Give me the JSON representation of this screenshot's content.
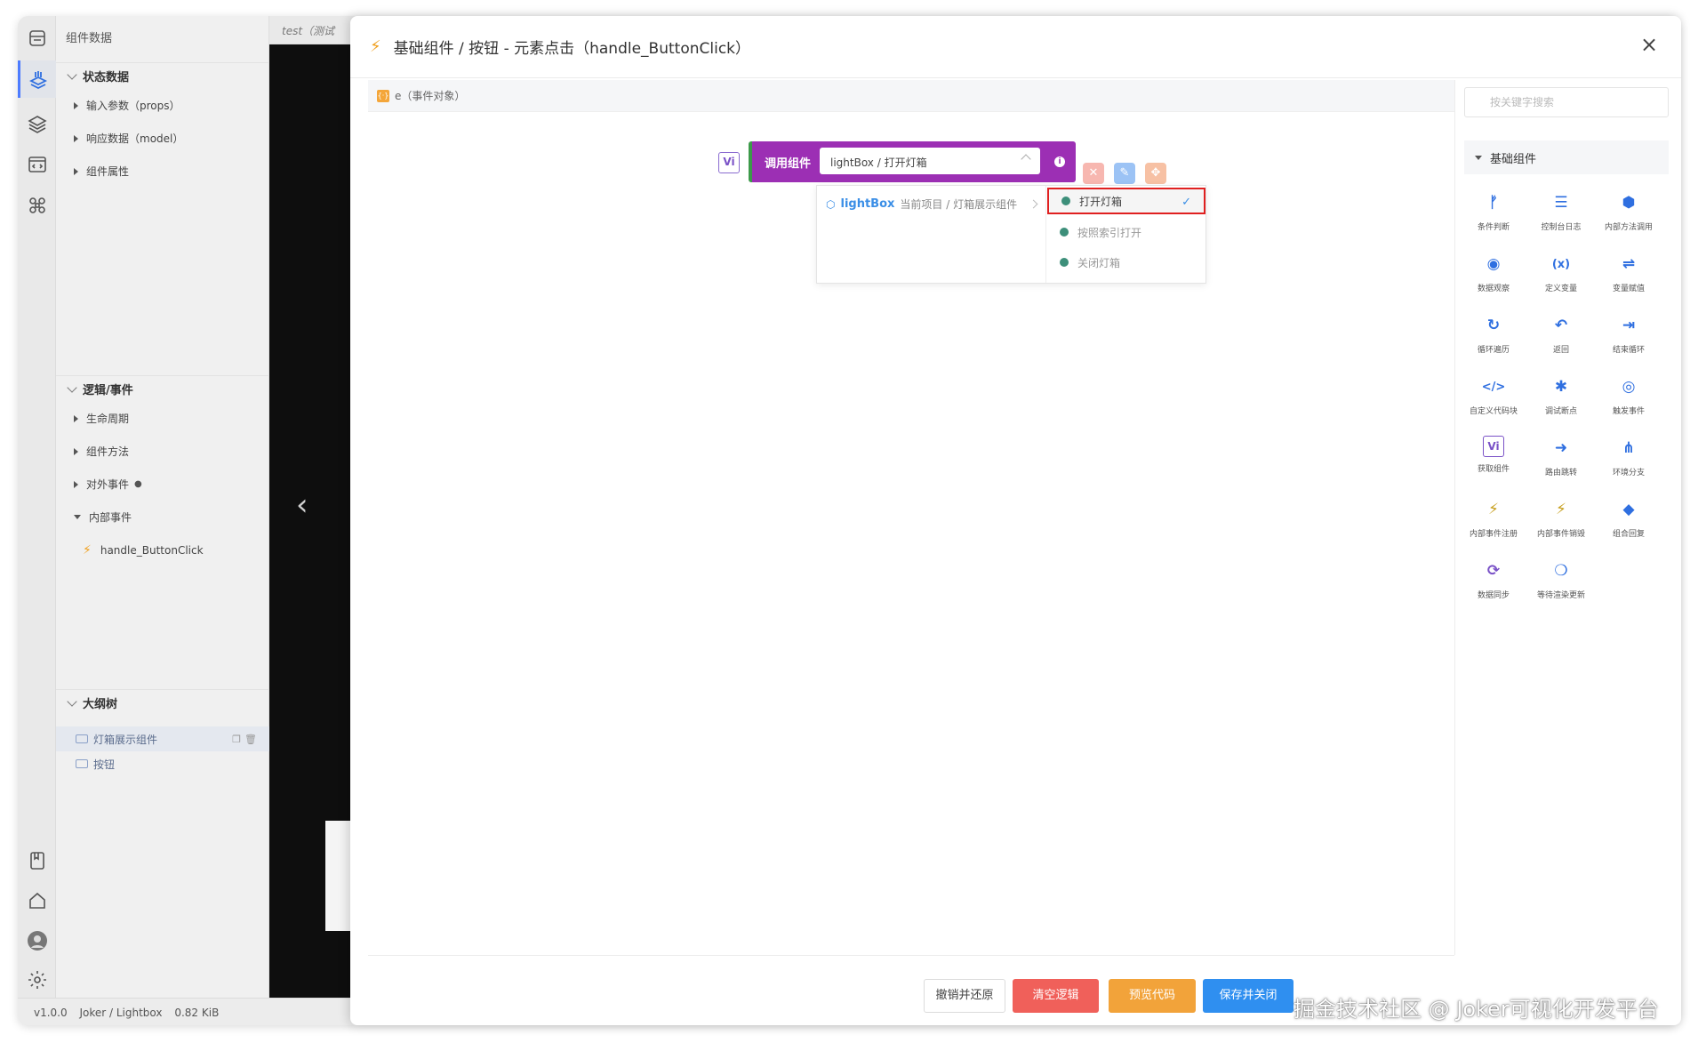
{
  "left_panel": {
    "title": "组件数据",
    "state_section": {
      "title": "状态数据",
      "items": [
        "输入参数（props）",
        "响应数据（model）",
        "组件属性"
      ]
    },
    "logic_section": {
      "title": "逻辑/事件",
      "items": [
        "生命周期",
        "组件方法",
        "对外事件",
        "内部事件"
      ],
      "handler": "handle_ButtonClick"
    },
    "outline_section": {
      "title": "大纲树",
      "nodes": [
        "灯箱展示组件",
        "按钮"
      ]
    }
  },
  "preview": {
    "tab_label": "test（测试"
  },
  "status_bar": {
    "version": "v1.0.0",
    "path": "Joker / Lightbox",
    "size": "0.82 KiB"
  },
  "modal": {
    "title": "基础组件 / 按钮 - 元素点击（handle_ButtonClick）",
    "close_label": "×",
    "event_param": "e（事件对象）",
    "block": {
      "badge": "Vi",
      "label": "调用组件",
      "selected_value": "lightBox / 打开灯箱"
    },
    "dropdown": {
      "left_option": {
        "name": "lightBox",
        "desc": "当前项目 / 灯箱展示组件"
      },
      "methods": [
        {
          "label": "打开灯箱",
          "selected": true
        },
        {
          "label": "按照索引打开",
          "selected": false
        },
        {
          "label": "关闭灯箱",
          "selected": false
        }
      ]
    },
    "palette": {
      "search_placeholder": "按关键字搜索",
      "group_title": "基础组件",
      "items": [
        {
          "label": "条件判断",
          "icon": "branch-icon",
          "color": "#2f6fe0"
        },
        {
          "label": "控制台日志",
          "icon": "log-icon",
          "color": "#2f6fe0"
        },
        {
          "label": "内部方法调用",
          "icon": "method-call-icon",
          "color": "#2f6fe0"
        },
        {
          "label": "数据观察",
          "icon": "eye-icon",
          "color": "#2f6fe0"
        },
        {
          "label": "定义变量",
          "icon": "variable-icon",
          "color": "#2f6fe0"
        },
        {
          "label": "变量赋值",
          "icon": "assign-icon",
          "color": "#2f6fe0"
        },
        {
          "label": "循环遍历",
          "icon": "loop-icon",
          "color": "#2f6fe0"
        },
        {
          "label": "返回",
          "icon": "return-icon",
          "color": "#2f6fe0"
        },
        {
          "label": "结束循环",
          "icon": "break-icon",
          "color": "#2f6fe0"
        },
        {
          "label": "自定义代码块",
          "icon": "code-icon",
          "color": "#2f6fe0"
        },
        {
          "label": "调试断点",
          "icon": "bug-icon",
          "color": "#2f6fe0"
        },
        {
          "label": "触发事件",
          "icon": "trigger-icon",
          "color": "#2f6fe0"
        },
        {
          "label": "获取组件",
          "icon": "get-component-icon",
          "color": "#7a52c7"
        },
        {
          "label": "路由跳转",
          "icon": "route-icon",
          "color": "#2f6fe0"
        },
        {
          "label": "环境分支",
          "icon": "env-branch-icon",
          "color": "#2f6fe0"
        },
        {
          "label": "内部事件注册",
          "icon": "event-register-icon",
          "color": "#c7a020"
        },
        {
          "label": "内部事件销毁",
          "icon": "event-destroy-icon",
          "color": "#c7a020"
        },
        {
          "label": "组合回复",
          "icon": "combine-icon",
          "color": "#2f6fe0"
        },
        {
          "label": "数据同步",
          "icon": "sync-icon",
          "color": "#7a52c7"
        },
        {
          "label": "等待渲染更新",
          "icon": "wait-render-icon",
          "color": "#2f6fe0"
        }
      ]
    },
    "footer": {
      "undo_label": "撤销并还原",
      "clear_label": "清空逻辑",
      "preview_label": "预览代码",
      "save_label": "保存并关闭"
    }
  },
  "watermark": "掘金技术社区 @ Joker可视化开发平台",
  "colors": {
    "block": "#9c2fb4",
    "clear": "#f0605a",
    "preview": "#f2a33a",
    "save": "#2f8ff0",
    "selected_border": "#e02020"
  }
}
